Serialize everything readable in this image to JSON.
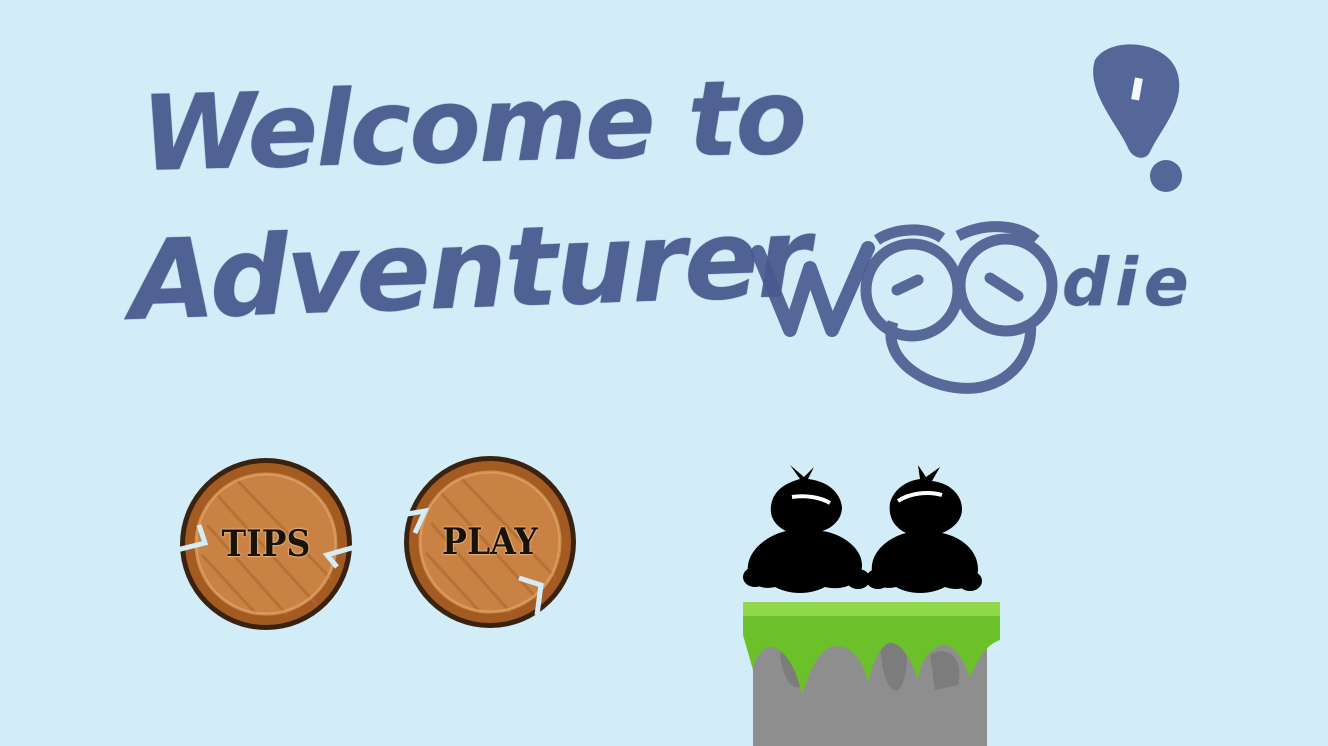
{
  "title": {
    "line1": "Welcome to",
    "line2_word1": "Adventurer",
    "line2_word2_start": "Woo",
    "line2_word2_end": "die",
    "exclamation": "!"
  },
  "menu": {
    "tips_label": "TIPS",
    "play_label": "PLAY"
  },
  "colors": {
    "background": "#d2edf8",
    "ink": "#4a5a8f",
    "wood": "#c98244",
    "wood_dark": "#8a4a1e",
    "grass": "#6cc12b",
    "stone": "#8e8e8e"
  },
  "icons": {
    "tips_button_shape": "wood-log-slice",
    "play_button_shape": "wood-log-slice",
    "characters": "creature-silhouette",
    "platform": "grass-stone-pillar"
  }
}
